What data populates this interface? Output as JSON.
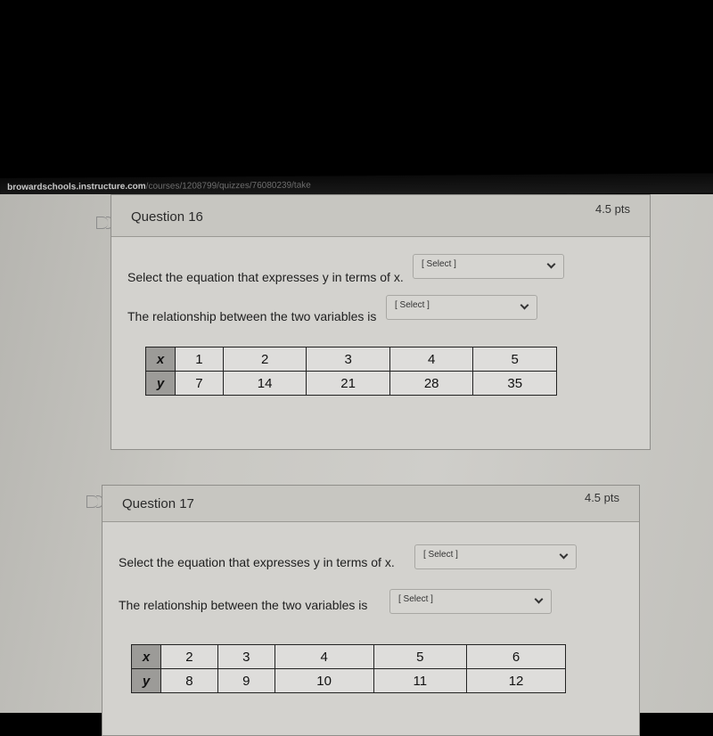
{
  "browser": {
    "url_domain": "browardschools.instructure.com",
    "url_path": "/courses/1208799/quizzes/76080239/take"
  },
  "questions": [
    {
      "title": "Question 16",
      "points": "4.5 pts",
      "prompt_equation": "Select the equation that expresses y in terms of x.",
      "prompt_relationship": "The relationship between the two variables is",
      "select_equation": "[ Select ]",
      "select_relationship": "[ Select ]",
      "table": {
        "x_label": "x",
        "y_label": "y",
        "x": [
          "1",
          "2",
          "3",
          "4",
          "5"
        ],
        "y": [
          "7",
          "14",
          "21",
          "28",
          "35"
        ]
      }
    },
    {
      "title": "Question 17",
      "points": "4.5 pts",
      "prompt_equation": "Select the equation that expresses y in terms of x.",
      "prompt_relationship": "The relationship between the two variables is",
      "select_equation": "[ Select ]",
      "select_relationship": "[ Select ]",
      "table": {
        "x_label": "x",
        "y_label": "y",
        "x": [
          "2",
          "3",
          "4",
          "5",
          "6"
        ],
        "y": [
          "8",
          "9",
          "10",
          "11",
          "12"
        ]
      }
    }
  ]
}
